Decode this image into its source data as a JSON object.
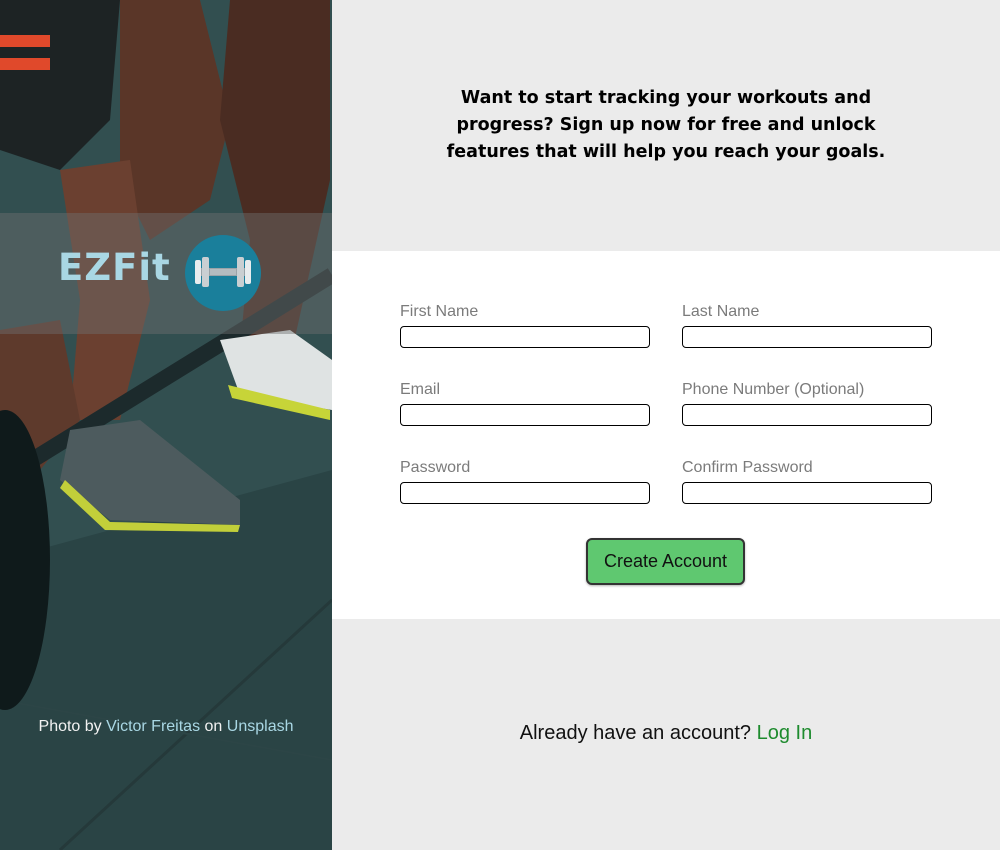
{
  "brand": {
    "name": "EZFit",
    "logo_icon": "dumbbell-icon",
    "logo_color": "#1a7f9b",
    "name_color": "#a9d7e4"
  },
  "photo_credit": {
    "prefix": "Photo by",
    "author": "Victor Freitas",
    "middle": "on",
    "source": "Unsplash"
  },
  "intro": {
    "text": "Want to start tracking your workouts and progress? Sign up now for free and unlock features that will help you reach your goals."
  },
  "form": {
    "first_name_label": "First Name",
    "last_name_label": "Last Name",
    "email_label": "Email",
    "phone_label": "Phone Number (Optional)",
    "password_label": "Password",
    "confirm_password_label": "Confirm Password",
    "submit_label": "Create Account",
    "submit_color": "#5fc870"
  },
  "login": {
    "prompt": "Already have an account?",
    "link_label": "Log In",
    "link_color": "#1e8b2e"
  }
}
